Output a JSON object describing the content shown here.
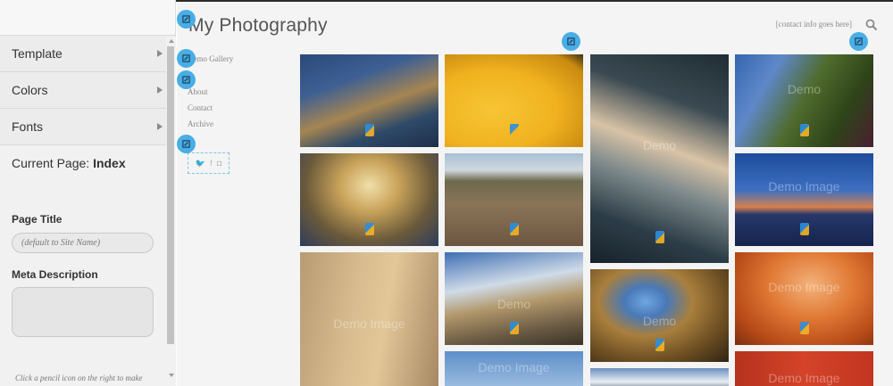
{
  "editor": {
    "sections": [
      {
        "label": "Template"
      },
      {
        "label": "Colors"
      },
      {
        "label": "Fonts"
      }
    ],
    "current_page_prefix": "Current Page:",
    "current_page_name": "Index",
    "page_title_label": "Page Title",
    "page_title_placeholder": "(default to Site Name)",
    "meta_description_label": "Meta Description",
    "meta_description_value": "",
    "hint_text": "Click a pencil icon on the right to make"
  },
  "site": {
    "title": "My Photography",
    "contact": "[contact info goes here]",
    "nav": [
      "Demo Gallery",
      "About",
      "Contact",
      "Archive"
    ],
    "social": [
      "twitter-icon",
      "facebook-icon",
      "instagram-icon"
    ],
    "photos": [
      {
        "name": "coastal-village-night",
        "watermark": ""
      },
      {
        "name": "yellow-tree-shadow",
        "watermark": ""
      },
      {
        "name": "ocean-wave-aerial",
        "watermark": "Demo"
      },
      {
        "name": "grape-vines",
        "watermark": "Demo"
      },
      {
        "name": "ornate-ceiling",
        "watermark": ""
      },
      {
        "name": "dry-landscape",
        "watermark": ""
      },
      {
        "name": "blue-lake-sunset",
        "watermark": "Demo Image"
      },
      {
        "name": "sunlit-wall",
        "watermark": "Demo Image"
      },
      {
        "name": "roman-ruins",
        "watermark": "Demo"
      },
      {
        "name": "courtyard-looking-up",
        "watermark": "Demo"
      },
      {
        "name": "orange-grass",
        "watermark": "Demo Image"
      },
      {
        "name": "blue-sky-mountain",
        "watermark": "Demo Image"
      },
      {
        "name": "snow-mountain",
        "watermark": ""
      },
      {
        "name": "red-detail",
        "watermark": "Demo Image"
      }
    ]
  },
  "colors": {
    "pencil": "#48aee5",
    "sidebar_bg": "#f1f1f1",
    "site_bg": "#f4f4f4"
  }
}
